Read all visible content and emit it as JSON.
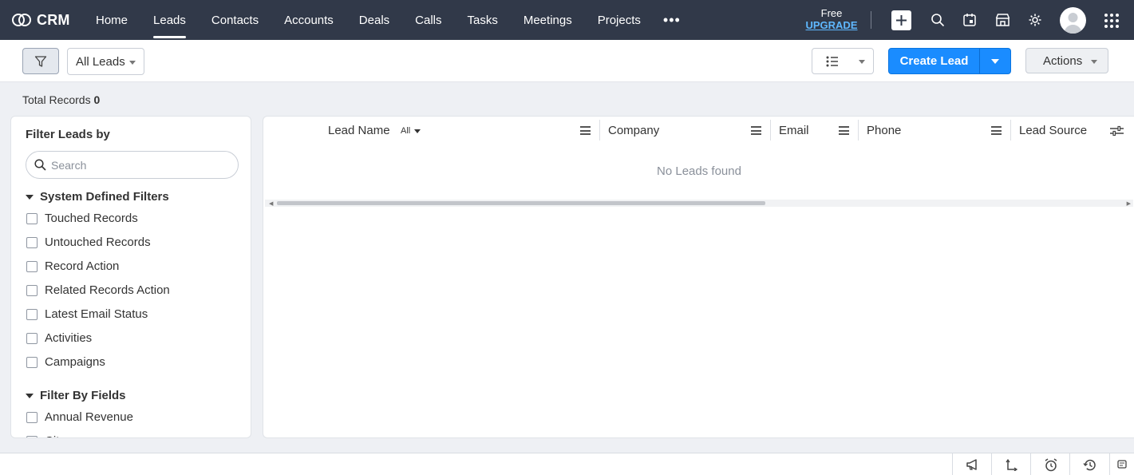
{
  "app": {
    "brand": "CRM"
  },
  "nav": {
    "items": [
      {
        "label": "Home",
        "active": false
      },
      {
        "label": "Leads",
        "active": true
      },
      {
        "label": "Contacts",
        "active": false
      },
      {
        "label": "Accounts",
        "active": false
      },
      {
        "label": "Deals",
        "active": false
      },
      {
        "label": "Calls",
        "active": false
      },
      {
        "label": "Tasks",
        "active": false
      },
      {
        "label": "Meetings",
        "active": false
      },
      {
        "label": "Projects",
        "active": false
      }
    ],
    "more": "•••",
    "plan": "Free",
    "upgrade": "UPGRADE"
  },
  "toolbar": {
    "view": "All Leads",
    "create_label": "Create Lead",
    "actions_label": "Actions"
  },
  "summary": {
    "total_label": "Total Records",
    "total_count": "0"
  },
  "filters": {
    "title": "Filter Leads by",
    "search_placeholder": "Search",
    "system_title": "System Defined Filters",
    "system_items": [
      "Touched Records",
      "Untouched Records",
      "Record Action",
      "Related Records Action",
      "Latest Email Status",
      "Activities",
      "Campaigns"
    ],
    "fields_title": "Filter By Fields",
    "field_items": [
      "Annual Revenue",
      "City"
    ]
  },
  "table": {
    "columns": [
      "Lead Name",
      "Company",
      "Email",
      "Phone",
      "Lead Source"
    ],
    "name_filter": "All",
    "empty_message": "No Leads found"
  },
  "colors": {
    "nav_bg": "#313949",
    "primary": "#1a8cff",
    "upgrade": "#5fb8ff"
  }
}
